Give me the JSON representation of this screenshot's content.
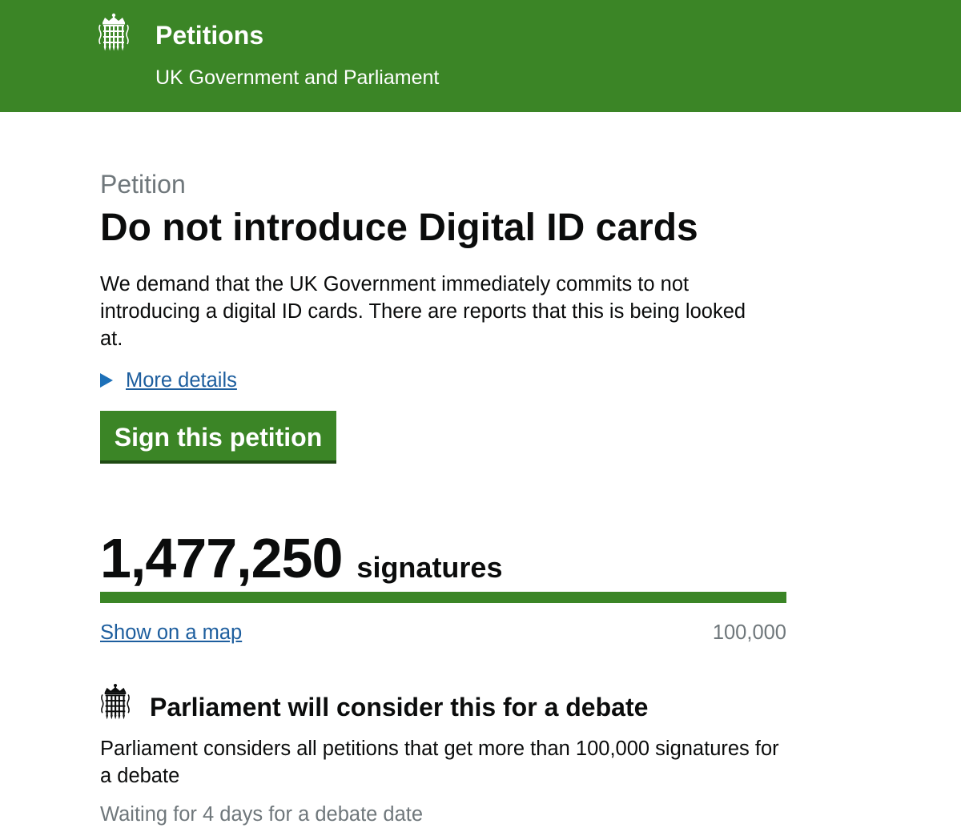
{
  "colors": {
    "header_bg": "#3b8526",
    "button_bg": "#3b8526",
    "progress_fill": "#3b8526",
    "link": "#1d5e9e",
    "secondary_text": "#6f777b"
  },
  "header": {
    "logo_icon": "portcullis-icon",
    "title": "Petitions",
    "subtitle": "UK Government and Parliament"
  },
  "petition": {
    "caption": "Petition",
    "title": "Do not introduce Digital ID cards",
    "description": "We demand that the UK Government immediately commits to not introducing a digital ID cards. There are reports that this is being looked at.",
    "more_details_label": "More details",
    "sign_button_label": "Sign this petition"
  },
  "signatures": {
    "count": "1,477,250",
    "label": "signatures",
    "map_link_label": "Show on a map",
    "threshold": "100,000",
    "progress_fraction": 1.0
  },
  "debate": {
    "icon": "portcullis-icon",
    "heading": "Parliament will consider this for a debate",
    "text": "Parliament considers all petitions that get more than 100,000 signatures for a debate",
    "status": "Waiting for 4 days for a debate date"
  }
}
